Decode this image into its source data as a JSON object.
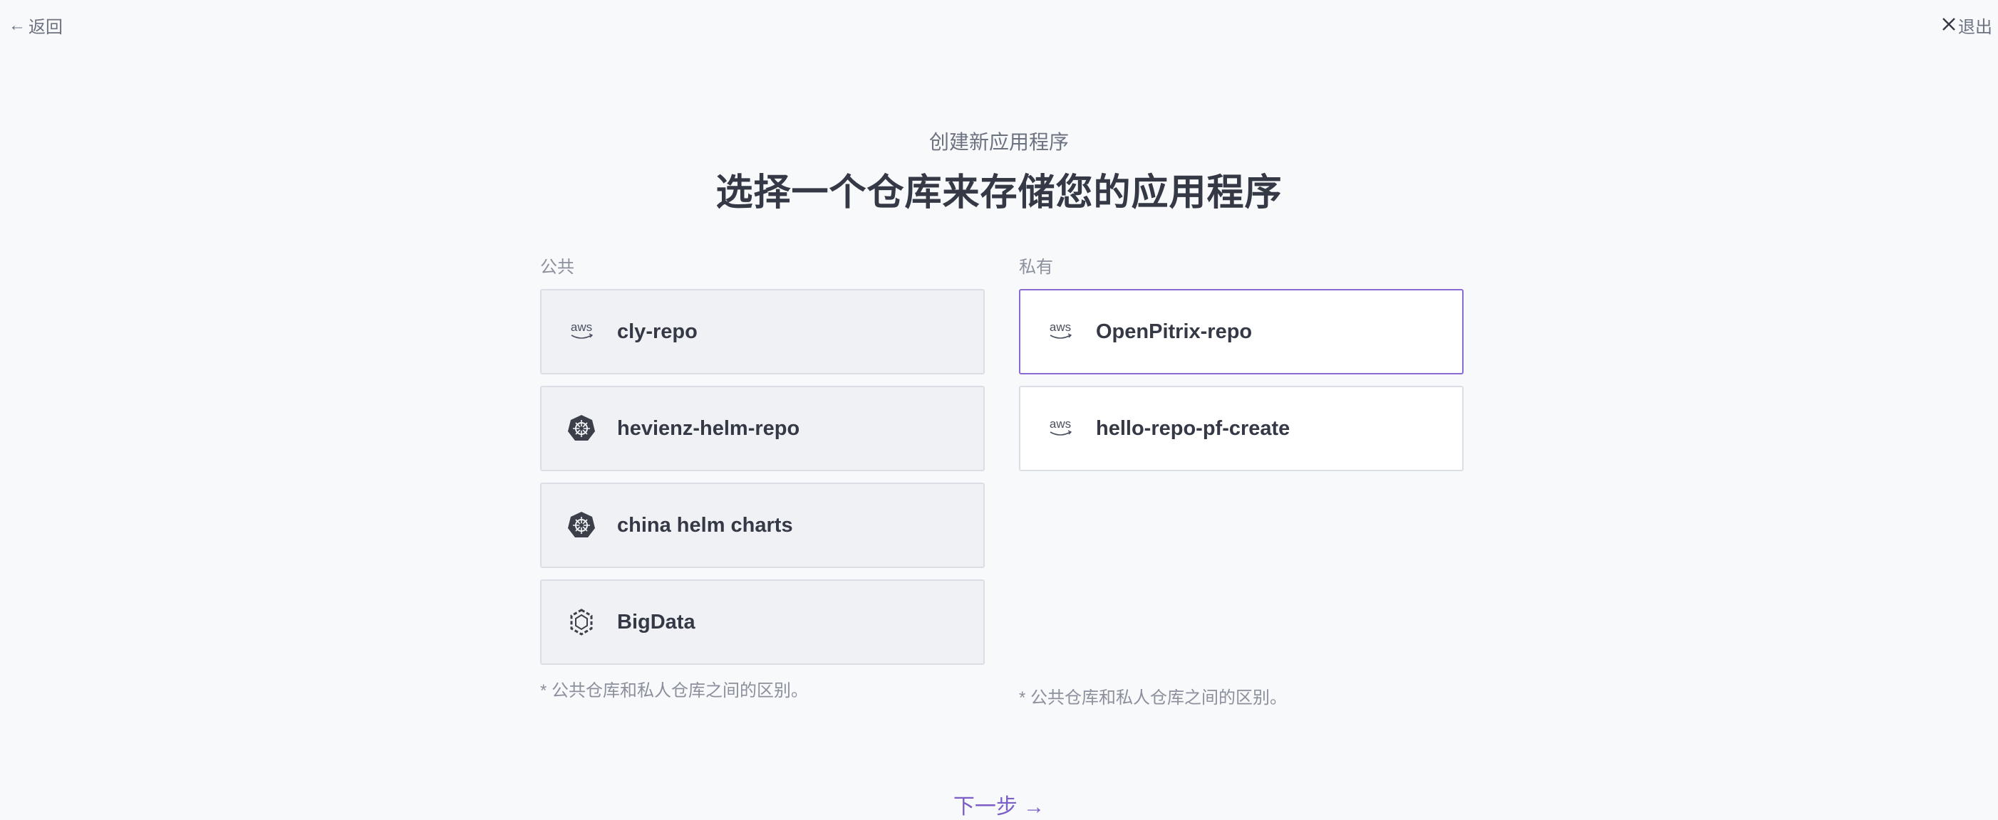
{
  "nav": {
    "back_arrow": "←",
    "back_label": "返回",
    "exit_label": "退出"
  },
  "header": {
    "subtitle": "创建新应用程序",
    "title": "选择一个仓库来存储您的应用程序"
  },
  "public": {
    "label": "公共",
    "repos": [
      {
        "name": "cly-repo",
        "icon": "aws-icon"
      },
      {
        "name": "hevienz-helm-repo",
        "icon": "helm-icon"
      },
      {
        "name": "china helm charts",
        "icon": "helm-icon"
      },
      {
        "name": "BigData",
        "icon": "bigdata-icon"
      }
    ],
    "note": "* 公共仓库和私人仓库之间的区别。"
  },
  "private": {
    "label": "私有",
    "repos": [
      {
        "name": "OpenPitrix-repo",
        "icon": "aws-icon"
      },
      {
        "name": "hello-repo-pf-create",
        "icon": "aws-icon"
      }
    ],
    "note": "* 公共仓库和私人仓库之间的区别。"
  },
  "footer": {
    "next_label": "下一步 →"
  },
  "colors": {
    "accent": "#7b5fc7",
    "selected_border": "#8a6bd4",
    "page_bg": "#f8f9fb"
  }
}
